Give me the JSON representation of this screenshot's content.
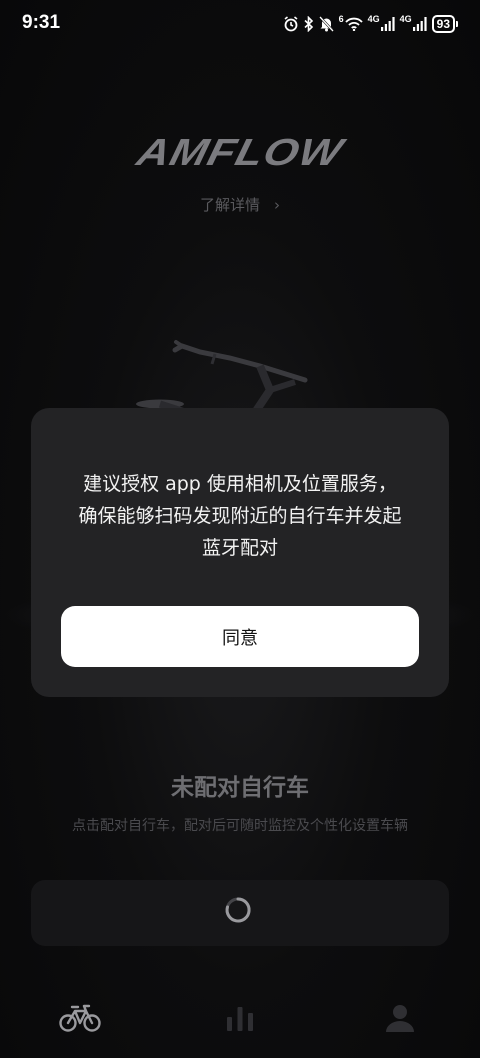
{
  "status_bar": {
    "time": "9:31",
    "network_label_1": "4G",
    "network_label_2": "4G",
    "wifi_label": "6",
    "battery": "93",
    "icons": [
      "alarm-icon",
      "bluetooth-icon",
      "mute-icon",
      "wifi-icon",
      "signal-icon",
      "signal-icon",
      "battery-icon"
    ]
  },
  "brand": {
    "logo": "AMFLOW",
    "learn_more": "了解详情",
    "learn_more_chevron": "›"
  },
  "dialog": {
    "message": "建议授权 app 使用相机及位置服务，\n确保能够扫码发现附近的自行车并发起\n蓝牙配对",
    "agree_label": "同意"
  },
  "pairing": {
    "title": "未配对自行车",
    "description": "点击配对自行车，配对后可随时监控及个性化设置车辆"
  },
  "bottom_nav": {
    "items": [
      {
        "icon": "bike-icon",
        "active": true
      },
      {
        "icon": "stats-icon",
        "active": false
      },
      {
        "icon": "profile-icon",
        "active": false
      }
    ]
  },
  "colors": {
    "background": "#0b0b0c",
    "dialog": "#232325",
    "button": "#ffffff",
    "muted_text": "#6e6e72"
  }
}
